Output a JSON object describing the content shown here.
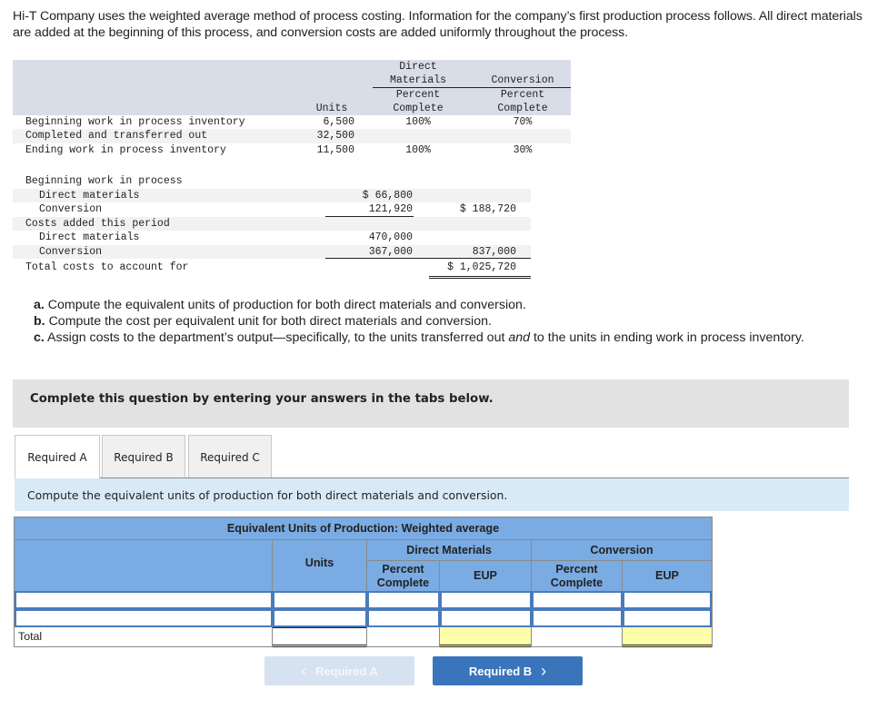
{
  "intro": "Hi-T Company uses the weighted average method of process costing. Information for the company’s first production process follows. All direct materials are added at the beginning of this process, and conversion costs are added uniformly throughout the process.",
  "units_table": {
    "headers": {
      "units": "Units",
      "dm_group_line1": "Direct",
      "dm_group_line2": "Materials",
      "conv_group": "Conversion",
      "pct_line1": "Percent",
      "pct_line2": "Complete"
    },
    "rows": [
      {
        "label": "Beginning work in process inventory",
        "units": "6,500",
        "dm": "100%",
        "conv": "70%"
      },
      {
        "label": "Completed and transferred out",
        "units": "32,500",
        "dm": "",
        "conv": ""
      },
      {
        "label": "Ending work in process inventory",
        "units": "11,500",
        "dm": "100%",
        "conv": "30%"
      }
    ]
  },
  "cost_table": {
    "rows": [
      {
        "label": "Beginning work in process",
        "indent": false,
        "col1": "",
        "col2": ""
      },
      {
        "label": "Direct materials",
        "indent": true,
        "col1": "$ 66,800",
        "col2": ""
      },
      {
        "label": "Conversion",
        "indent": true,
        "col1": "121,920",
        "col2": "$ 188,720"
      },
      {
        "label": "Costs added this period",
        "indent": false,
        "col1": "",
        "col2": ""
      },
      {
        "label": "Direct materials",
        "indent": true,
        "col1": "470,000",
        "col2": ""
      },
      {
        "label": "Conversion",
        "indent": true,
        "col1": "367,000",
        "col2": "837,000"
      },
      {
        "label": "Total costs to account for",
        "indent": false,
        "col1": "",
        "col2": "$ 1,025,720"
      }
    ]
  },
  "requirements": [
    {
      "letter": "a.",
      "text": "Compute the equivalent units of production for both direct materials and conversion."
    },
    {
      "letter": "b.",
      "text": "Compute the cost per equivalent unit for both direct materials and conversion."
    },
    {
      "letter": "c.",
      "text_before": "Assign costs to the department’s output—specifically, to the units transferred out ",
      "text_em": "and",
      "text_after": " to the units in ending work in process inventory."
    }
  ],
  "banner": "Complete this question by entering your answers in the tabs below.",
  "tabs": [
    {
      "label": "Required A",
      "active": true
    },
    {
      "label": "Required B",
      "active": false
    },
    {
      "label": "Required C",
      "active": false
    }
  ],
  "instruction": "Compute the equivalent units of production for both direct materials and conversion.",
  "eup_table": {
    "title": "Equivalent Units of Production: Weighted average",
    "units_header": "Units",
    "dm_header": "Direct Materials",
    "conv_header": "Conversion",
    "pct_header": "Percent Complete",
    "eup_header": "EUP",
    "rows": [
      {
        "label": "",
        "units": "",
        "dm_pct": "",
        "dm_eup": "",
        "conv_pct": "",
        "conv_eup": ""
      },
      {
        "label": "",
        "units": "",
        "dm_pct": "",
        "dm_eup": "",
        "conv_pct": "",
        "conv_eup": ""
      }
    ],
    "total_label": "Total",
    "total_units": "",
    "total_dm_eup": "",
    "total_conv_eup": ""
  },
  "nav": {
    "prev_label": "Required A",
    "next_label": "Required B",
    "prev_icon": "‹",
    "next_icon": "›"
  }
}
